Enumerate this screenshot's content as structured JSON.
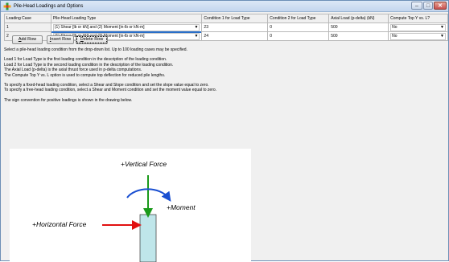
{
  "window": {
    "title": "Pile-Head Loadings and Options"
  },
  "table": {
    "headers": [
      "Loading Case",
      "Pile-Head Loading Type",
      "Condition 1 for Load Type",
      "Condition 2 for Load Type",
      "Axial Load (p-delta) (kN)",
      "Compute Top Y vs. L?"
    ],
    "rows": [
      {
        "case": "1",
        "type": "(1) Shear [lb or kN] and (2) Moment [in-lb or kN-m]",
        "cond1": "23",
        "cond2": "0",
        "axial": "500",
        "compute": "No"
      },
      {
        "case": "2",
        "type": "(1) Shear [lb or kN] and (2) Moment [in-lb or kN-m]",
        "cond1": "24",
        "cond2": "0",
        "axial": "500",
        "compute": "No"
      }
    ]
  },
  "buttons": {
    "add_row": {
      "mnemonic": "A",
      "rest": "dd Row"
    },
    "insert_row": {
      "mnemonic": "I",
      "rest": "nsert Row"
    },
    "delete_row": {
      "mnemonic": "D",
      "rest": "elete Row"
    }
  },
  "help": {
    "line1": "Select a pile-head loading condition from the drop-down list. Up to 100 loading cases may be specified.",
    "line2": "Load 1 for Load Type is the first loading condition in the description of the loading condition.",
    "line3": "Load 2 for Load Type is the second loading condition in the description of the loading condition.",
    "line4": "The Axial Load (p-delta) is the axial thrust force used in p-delta computations.",
    "line5": "The Compute Top Y vs. L option is used to compute top deflection for reduced pile lengths.",
    "line6": "To specify a fixed-head loading condition, select a Shear and Slope condition and set the slope value equal to zero.",
    "line7": "To specify a free-head loading condition, select a Shear and Moment condition and set the moment value equal to zero.",
    "line8": "The sign convention for positive loadings is shown in the drawing below."
  },
  "drawing": {
    "vertical_force": "+Vertical Force",
    "moment": "+Moment",
    "horizontal_force": "+Horizontal Force",
    "colors": {
      "vertical": "#1a9a1a",
      "horizontal": "#e11010",
      "moment": "#1a4fd1",
      "pile": "#bfe6ea"
    }
  }
}
